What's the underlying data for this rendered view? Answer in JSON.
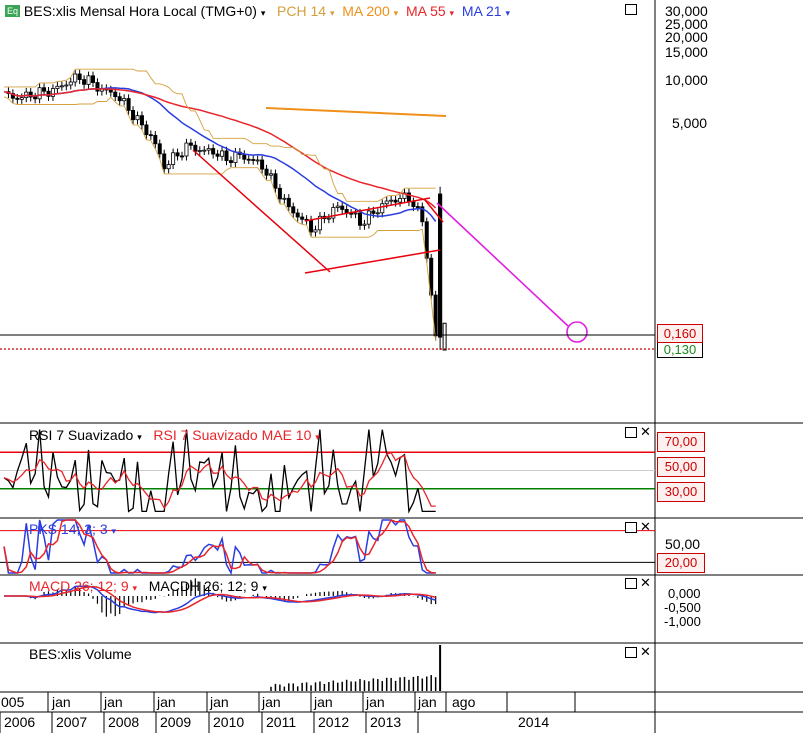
{
  "symbol_badge": "Eq",
  "main_panel": {
    "title": "BES:xlis Mensal Hora Local (TMG+0)",
    "indicators": [
      {
        "label": "PCH 14",
        "color": "#d4a03c"
      },
      {
        "label": "MA 200",
        "color": "#f0901a"
      },
      {
        "label": "MA 55",
        "color": "#e8252a"
      },
      {
        "label": "MA 21",
        "color": "#2a3de0"
      }
    ],
    "price_ticks": [
      "30,000",
      "25,000",
      "20,000",
      "15,000",
      "10,000",
      "5,000"
    ],
    "last_price_label": "0,160",
    "last_price_label2": "0,130"
  },
  "rsi_panel": {
    "title": "RSI 7 Suavizado",
    "title2": "RSI 7 Suavizado MAE 10",
    "levels": [
      "70,00",
      "50,00",
      "30,00"
    ]
  },
  "pks_panel": {
    "title": "PKS 14; 3; 3",
    "levels": [
      "50,00",
      "20,00"
    ]
  },
  "macd_panel": {
    "title": "MACD 26; 12; 9",
    "title2": "MACDH 26; 12; 9",
    "levels": [
      "0,000",
      "-0,500",
      "-1,000"
    ]
  },
  "volume_panel": {
    "title": "BES:xlis Volume"
  },
  "time_axis": {
    "upper_labels": [
      "005",
      "jan",
      "jan",
      "jan",
      "jan",
      "jan",
      "jan",
      "jan",
      "jan",
      "jan",
      "ago"
    ],
    "lower_labels": [
      "2006",
      "2007",
      "2008",
      "2009",
      "2010",
      "2011",
      "2012",
      "2013",
      "2014"
    ]
  },
  "colors": {
    "candle_up": "#ffffff",
    "candle_down": "#000000",
    "resistance_line": "#e8000c",
    "projection_line": "#e020e0",
    "rsi_line": "#000000",
    "rsi_ma": "#e8252a",
    "level_70": "#e8000c",
    "level_30": "#008000"
  },
  "chart_data": {
    "type": "candlestick",
    "symbol": "BES:xlis",
    "interval": "monthly",
    "y_scale": "log",
    "price_close_by_year": {
      "2006": [
        8.0,
        7.5,
        7.8,
        8.2,
        8.5
      ],
      "2007": [
        9.5,
        10.5,
        9.8,
        8.5
      ],
      "2008": [
        8.0,
        6.5,
        5.0,
        4.0
      ],
      "2009": [
        2.5,
        3.0,
        3.5,
        3.2
      ],
      "2010": [
        3.2,
        2.8,
        3.0,
        2.8
      ],
      "2011": [
        2.5,
        1.8,
        1.3,
        1.1
      ],
      "2012": [
        0.9,
        1.1,
        1.3,
        1.2
      ],
      "2013": [
        1.0,
        1.2,
        1.4,
        1.5
      ],
      "2014": [
        1.5,
        1.0,
        0.16
      ]
    },
    "last_price": 0.16,
    "rsi_levels": [
      70,
      50,
      30
    ],
    "pks_levels": [
      50,
      20
    ],
    "macd_levels": [
      0,
      -0.5,
      -1.0
    ]
  }
}
